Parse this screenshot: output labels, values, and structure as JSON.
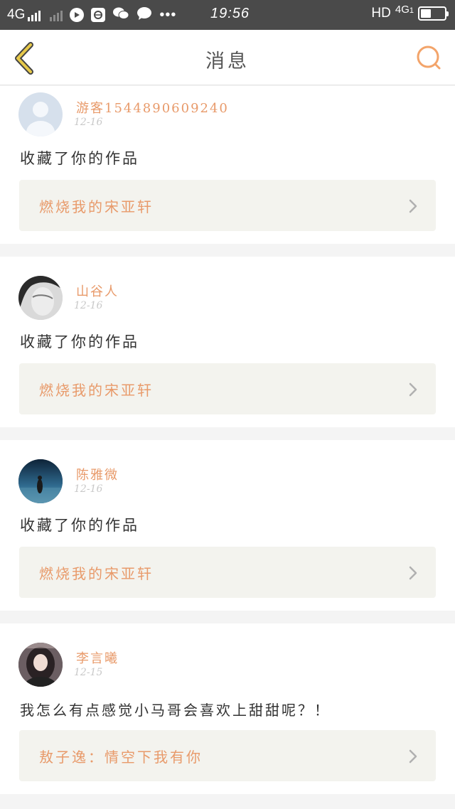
{
  "status_bar": {
    "network_left": "4G",
    "time": "19:56",
    "hd": "HD",
    "network_right": "4G",
    "sim": "1",
    "battery_level": 0.45,
    "icons": [
      "signal-icon",
      "signal-dim-icon",
      "play-icon",
      "browser-icon",
      "wechat-icon",
      "message-icon",
      "more-dots-icon",
      "battery-icon"
    ]
  },
  "header": {
    "title": "消息",
    "back_icon": "chevron-left-icon",
    "search_icon": "search-icon",
    "accent_color": "#f3a46a",
    "back_color": "#e7c94a"
  },
  "messages": [
    {
      "username": "游客1544890609240",
      "date": "12-16",
      "text": "收藏了你的作品",
      "work_title": "燃烧我的宋亚轩"
    },
    {
      "username": "山谷人",
      "date": "12-16",
      "text": "收藏了你的作品",
      "work_title": "燃烧我的宋亚轩"
    },
    {
      "username": "陈雅微",
      "date": "12-16",
      "text": "收藏了你的作品",
      "work_title": "燃烧我的宋亚轩"
    },
    {
      "username": "李言曦",
      "date": "12-15",
      "text": "我怎么有点感觉小马哥会喜欢上甜甜呢？！",
      "work_title": "敖子逸：情空下我有你"
    }
  ]
}
